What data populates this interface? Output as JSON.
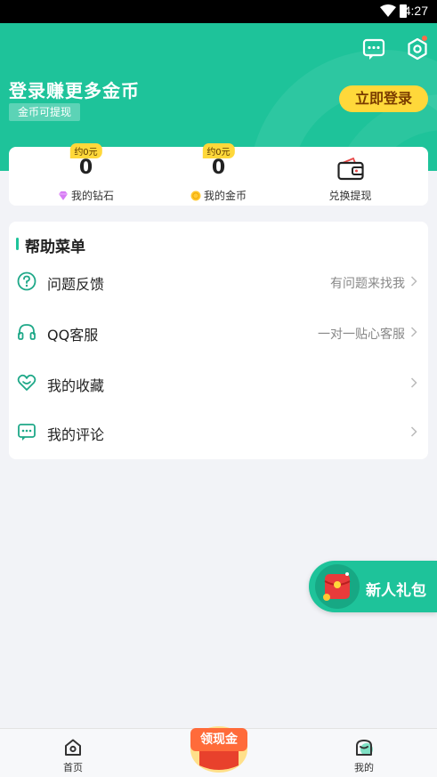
{
  "status_bar": {
    "time": "4:27"
  },
  "header": {
    "login_title": "登录赚更多金币",
    "coin_badge": "金币可提现",
    "login_button": "立即登录",
    "message_icon": "chat-bubble-icon",
    "settings_icon": "settings-icon",
    "accent_color": "#1ec39a",
    "button_color": "#ffd83a"
  },
  "stats": [
    {
      "tag": "约0元",
      "value": "0",
      "label": "我的钻石",
      "icon": "diamond-icon"
    },
    {
      "tag": "约0元",
      "value": "0",
      "label": "我的金币",
      "icon": "coin-icon"
    },
    {
      "label": "兑换提现",
      "icon": "wallet-icon"
    }
  ],
  "help_menu": {
    "title": "帮助菜单",
    "items": [
      {
        "label": "问题反馈",
        "hint": "有问题来找我",
        "icon": "question-circle-icon"
      },
      {
        "label": "QQ客服",
        "hint": "一对一贴心客服",
        "icon": "headphones-icon"
      },
      {
        "label": "我的收藏",
        "hint": "",
        "icon": "heart-icon"
      },
      {
        "label": "我的评论",
        "hint": "",
        "icon": "comment-icon"
      }
    ]
  },
  "gift": {
    "label": "新人礼包",
    "icon": "red-envelope-icon"
  },
  "tabbar": {
    "home": "首页",
    "cash": "领现金",
    "mine": "我的"
  }
}
